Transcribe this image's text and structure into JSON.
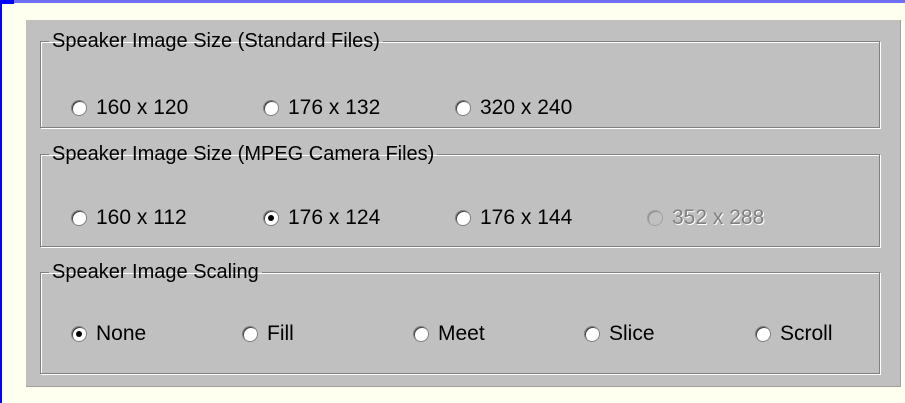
{
  "standard_files": {
    "title": "Speaker Image Size (Standard Files)",
    "options": [
      {
        "label": "160 x 120",
        "selected": false,
        "enabled": true
      },
      {
        "label": "176 x 132",
        "selected": false,
        "enabled": true
      },
      {
        "label": "320 x 240",
        "selected": false,
        "enabled": true
      }
    ]
  },
  "mpeg_files": {
    "title": "Speaker Image Size (MPEG Camera Files)",
    "options": [
      {
        "label": "160 x 112",
        "selected": false,
        "enabled": true
      },
      {
        "label": "176 x 124",
        "selected": true,
        "enabled": true
      },
      {
        "label": "176 x 144",
        "selected": false,
        "enabled": true
      },
      {
        "label": "352 x 288",
        "selected": false,
        "enabled": false
      }
    ]
  },
  "scaling": {
    "title": "Speaker Image Scaling",
    "options": [
      {
        "label": "None",
        "selected": true,
        "enabled": true
      },
      {
        "label": "Fill",
        "selected": false,
        "enabled": true
      },
      {
        "label": "Meet",
        "selected": false,
        "enabled": true
      },
      {
        "label": "Slice",
        "selected": false,
        "enabled": true
      },
      {
        "label": "Scroll",
        "selected": false,
        "enabled": true
      }
    ]
  },
  "colors": {
    "dialog_background": "#c0c0c0",
    "page_background": "#fffff0",
    "accent_blue": "#0000ff",
    "disabled_text": "#808080"
  }
}
